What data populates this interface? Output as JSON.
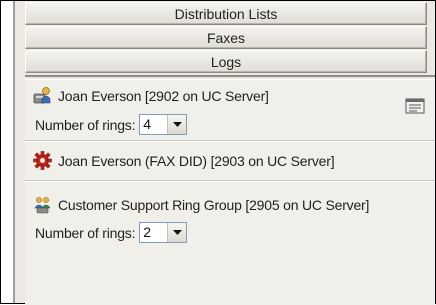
{
  "tabs": [
    {
      "label": "Distribution Lists"
    },
    {
      "label": "Faxes"
    },
    {
      "label": "Logs"
    }
  ],
  "entries": [
    {
      "icon": "user-phone-icon",
      "name": "Joan Everson [2902 on UC Server]",
      "rings_label": "Number of rings:",
      "rings_value": "4",
      "has_menu": true
    },
    {
      "icon": "fax-gear-icon",
      "name": "Joan Everson (FAX DID) [2903 on UC Server]"
    },
    {
      "icon": "ring-group-icon",
      "name": "Customer Support Ring Group [2905 on UC Server]",
      "rings_label": "Number of rings:",
      "rings_value": "2"
    }
  ],
  "colors": {
    "panel_bg": "#ece9e3",
    "card_bg": "#f1efea",
    "fax_icon": "#c0261b",
    "select_border": "#7f9db9"
  }
}
